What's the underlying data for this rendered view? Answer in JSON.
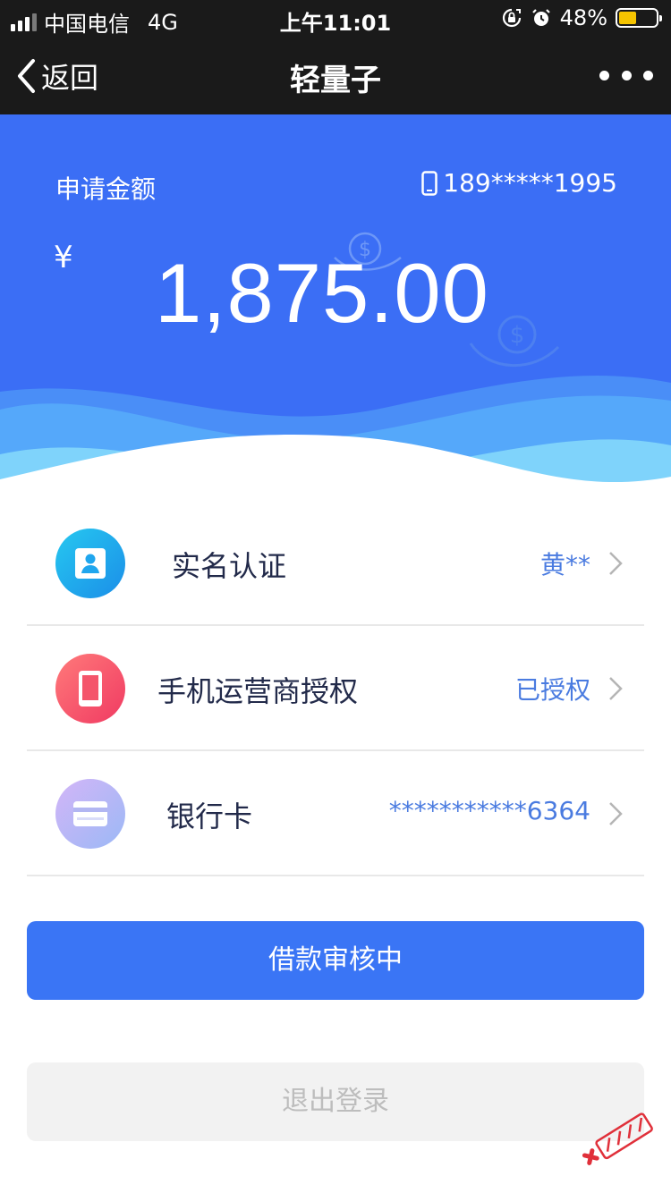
{
  "status_bar": {
    "carrier": "中国电信",
    "network": "4G",
    "time": "上午11:01",
    "battery_percent": "48%",
    "battery_level": 0.48,
    "icons": [
      "signal-icon",
      "rotation-lock-icon",
      "alarm-icon",
      "battery-icon"
    ]
  },
  "nav": {
    "back_label": "返回",
    "title": "轻量子",
    "back_icon": "chevron-left-icon",
    "more_icon": "more-dots-icon"
  },
  "hero": {
    "amount_label": "申请金额",
    "phone": "189*****1995",
    "phone_icon": "phone-icon",
    "currency": "¥",
    "amount": "1,875.00",
    "decor_icon": "dollar-coin-icon"
  },
  "rows": [
    {
      "label": "实名认证",
      "value": "黄**",
      "icon": "id-card-icon",
      "color": "#1fb6ee"
    },
    {
      "label": "手机运营商授权",
      "value": "已授权",
      "icon": "mobile-phone-icon",
      "color": "#f4556b"
    },
    {
      "label": "银行卡",
      "value": "***********6364",
      "icon": "bank-card-icon",
      "color": "#b7b9f5"
    }
  ],
  "buttons": {
    "primary": "借款审核中",
    "secondary": "退出登录"
  },
  "colors": {
    "hero_bg": "#3b6ef5",
    "accent": "#3a75f5",
    "value_text": "#4a7be0",
    "bar_bg": "#1a1a1a"
  }
}
